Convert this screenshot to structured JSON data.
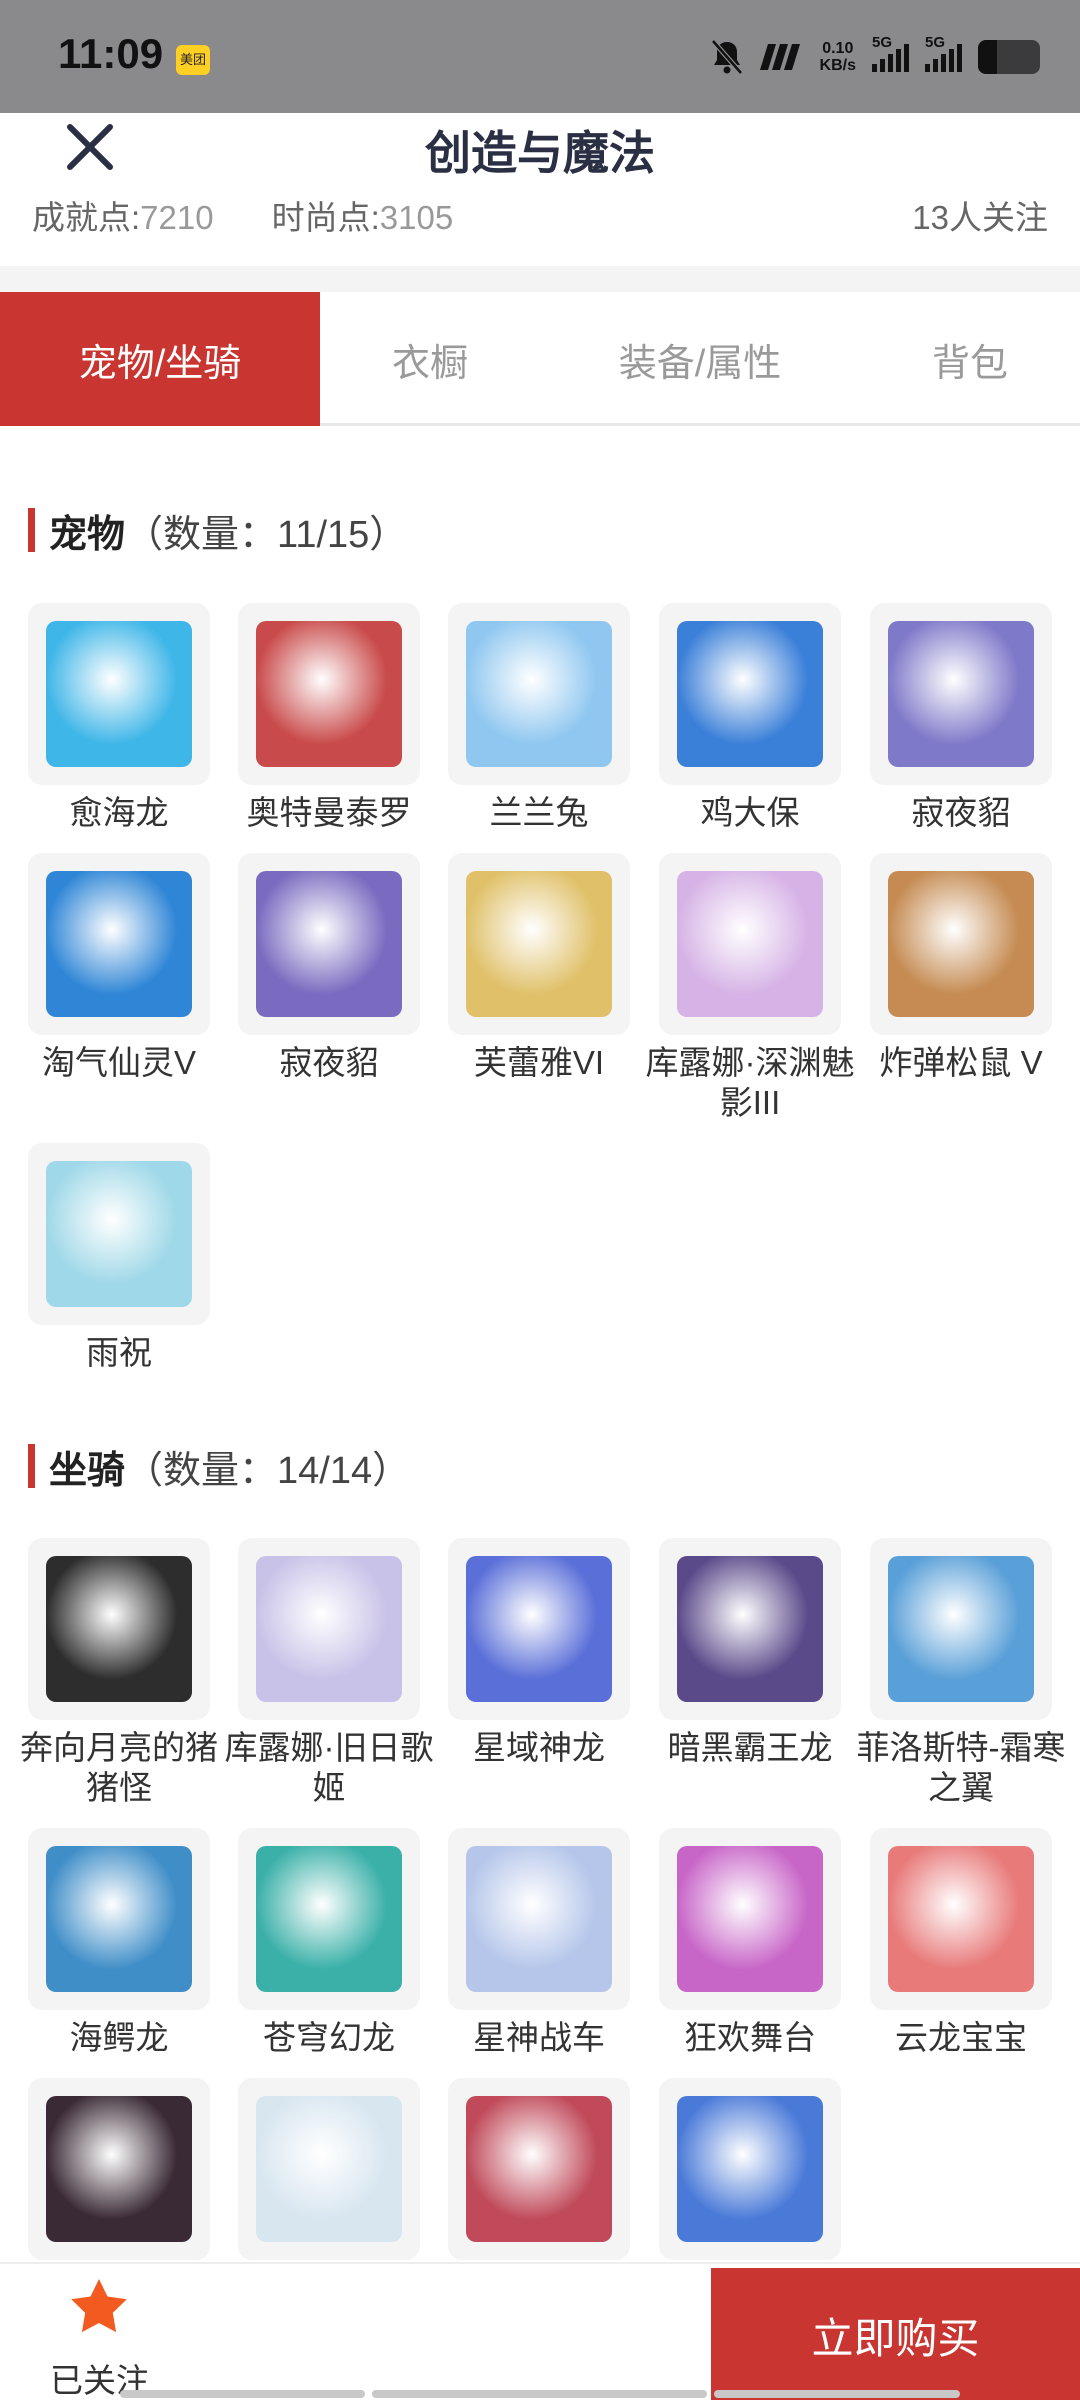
{
  "status_bar": {
    "time": "11:09",
    "app_badge": "美团",
    "net_speed_top": "0.10",
    "net_speed_bottom": "KB/s",
    "sim1": "5G",
    "sim2": "5G",
    "battery_level": 0.3
  },
  "header": {
    "title": "创造与魔法",
    "achievement_label": "成就点:",
    "achievement_value": "7210",
    "fashion_label": "时尚点:",
    "fashion_value": "3105",
    "followers": "13人关注"
  },
  "tabs": [
    {
      "label": "宠物/坐骑",
      "active": true
    },
    {
      "label": "衣橱",
      "active": false
    },
    {
      "label": "装备/属性",
      "active": false
    },
    {
      "label": "背包",
      "active": false
    }
  ],
  "pets": {
    "title": "宠物",
    "count": "（数量：11/15）",
    "items": [
      {
        "label": "愈海龙",
        "color": "#3fb6e8"
      },
      {
        "label": "奥特曼泰罗",
        "color": "#c94a4a"
      },
      {
        "label": "兰兰兔",
        "color": "#8fc7f0"
      },
      {
        "label": "鸡大保",
        "color": "#3a7fd8"
      },
      {
        "label": "寂夜貂",
        "color": "#7f79c9"
      },
      {
        "label": "淘气仙灵V",
        "color": "#2f86d6"
      },
      {
        "label": "寂夜貂",
        "color": "#7a6bc0"
      },
      {
        "label": "芙蕾雅VI",
        "color": "#e0c16a"
      },
      {
        "label": "库露娜·深渊魅影III",
        "color": "#d6b3e6"
      },
      {
        "label": "炸弹松鼠 V",
        "color": "#c58b52"
      },
      {
        "label": "雨祝",
        "color": "#9fd8e8"
      }
    ]
  },
  "mounts": {
    "title": "坐骑",
    "count": "（数量：14/14）",
    "items": [
      {
        "label": "奔向月亮的猪猪怪",
        "color": "#2d2d2d"
      },
      {
        "label": "库露娜·旧日歌姬",
        "color": "#c9c2e8"
      },
      {
        "label": "星域神龙",
        "color": "#5a6fd8"
      },
      {
        "label": "暗黑霸王龙",
        "color": "#5b4a8a"
      },
      {
        "label": "菲洛斯特-霜寒之翼",
        "color": "#5aa0d8"
      },
      {
        "label": "海鳄龙",
        "color": "#3f8ec8"
      },
      {
        "label": "苍穹幻龙",
        "color": "#3ab0a8"
      },
      {
        "label": "星神战车",
        "color": "#b5c6ea"
      },
      {
        "label": "狂欢舞台",
        "color": "#c866c8"
      },
      {
        "label": "云龙宝宝",
        "color": "#e87a7a"
      },
      {
        "label": "",
        "color": "#3a2a35"
      },
      {
        "label": "",
        "color": "#d8e6f0"
      },
      {
        "label": "",
        "color": "#c04a5a"
      },
      {
        "label": "",
        "color": "#4a7ad8"
      }
    ]
  },
  "bottom": {
    "follow_label": "已关注",
    "buy_label": "立即购买"
  }
}
